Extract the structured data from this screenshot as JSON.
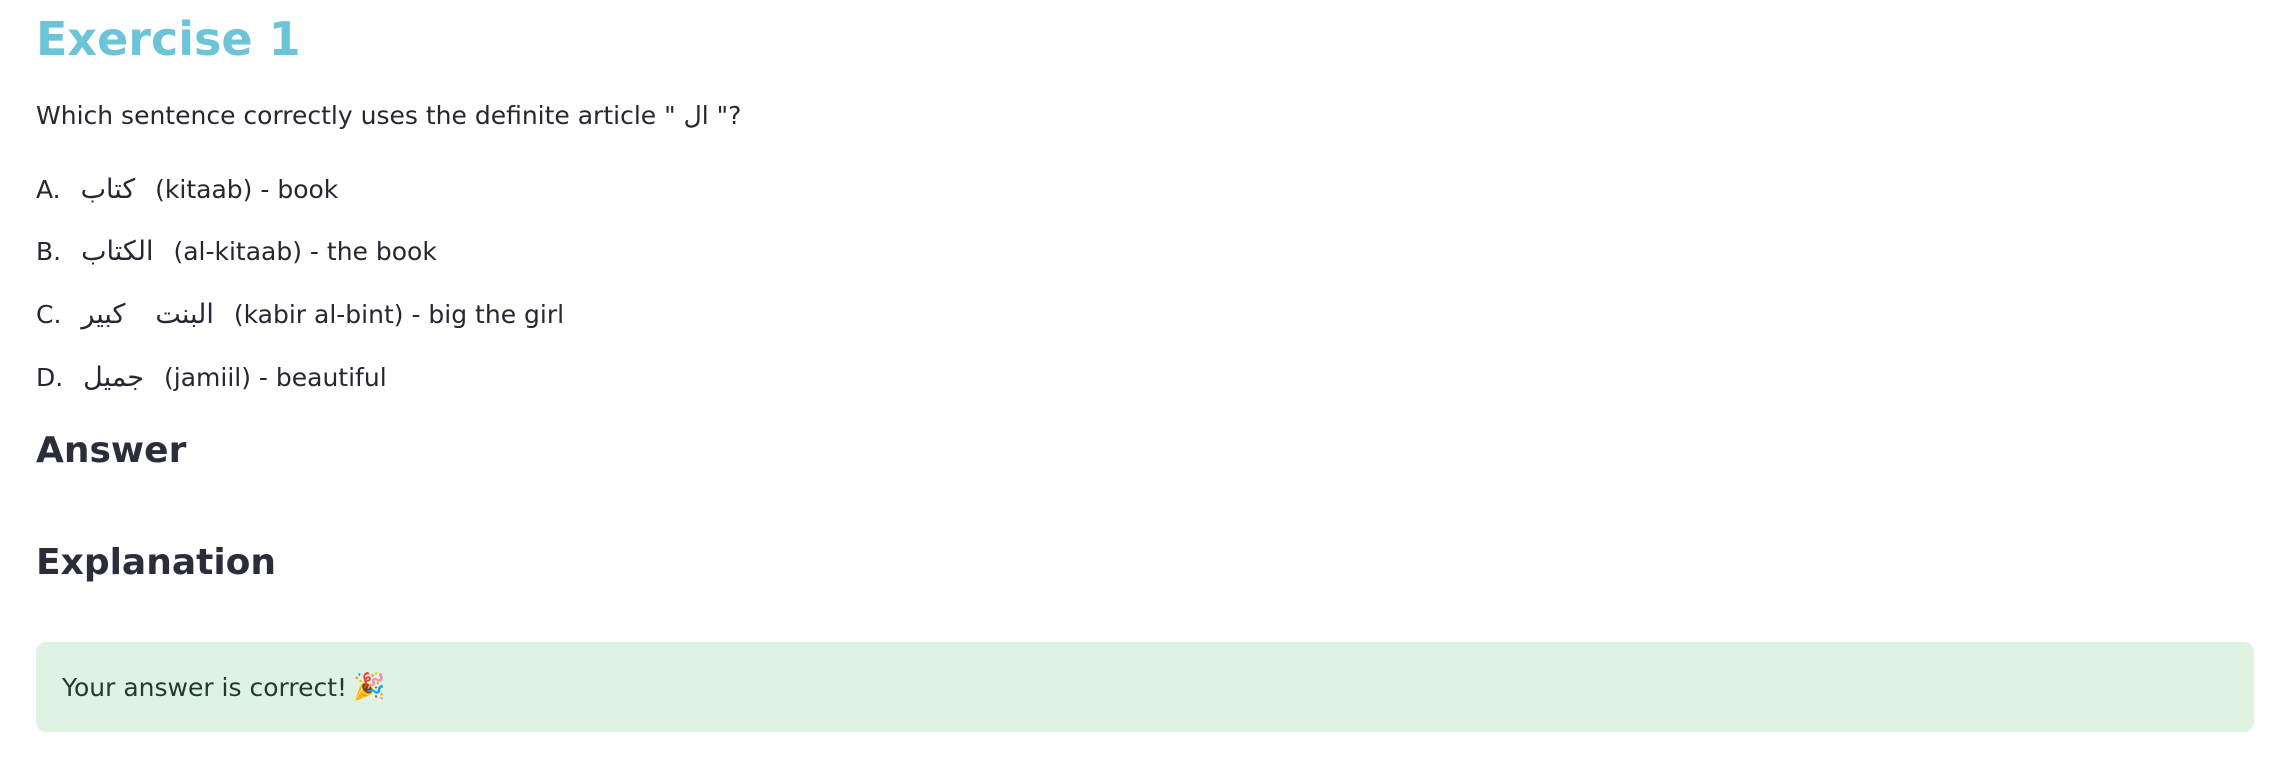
{
  "exercise": {
    "title": "Exercise 1",
    "question_prefix": "Which sentence correctly uses the definite article \"",
    "question_article": "ال",
    "question_suffix": "\"?"
  },
  "options": [
    {
      "letter": "A.",
      "arabic": "كتاب",
      "text": "(kitaab) - book"
    },
    {
      "letter": "B.",
      "arabic": "الكتاب",
      "text": "(al-kitaab) - the book"
    },
    {
      "letter": "C.",
      "arabic_1": "كبير",
      "arabic_2": "البنت",
      "text": "(kabir al-bint) - big the girl"
    },
    {
      "letter": "D.",
      "arabic": "جميل",
      "text": "(jamiil) - beautiful"
    }
  ],
  "answer": {
    "heading": "Answer"
  },
  "explanation": {
    "heading": "Explanation"
  },
  "feedback": {
    "message": "Your answer is correct!",
    "icon": "party-popper-icon",
    "icon_glyph": "🎉",
    "background": "#dff3e2"
  },
  "colors": {
    "title": "#6cc4d8",
    "heading": "#2b2d3a",
    "text": "#262730"
  }
}
